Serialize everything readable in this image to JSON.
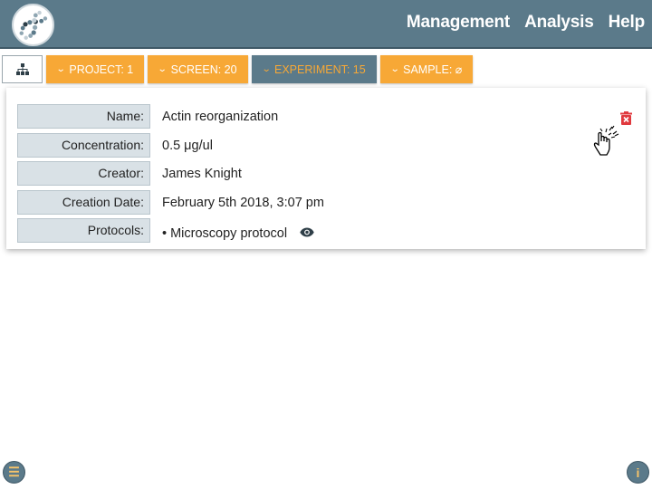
{
  "nav": {
    "items": [
      "Management",
      "Analysis",
      "Help"
    ]
  },
  "breadcrumbs": [
    {
      "label": "PROJECT: 1",
      "active": false
    },
    {
      "label": "SCREEN: 20",
      "active": false
    },
    {
      "label": "EXPERIMENT: 15",
      "active": true
    },
    {
      "label": "SAMPLE: ⌀",
      "active": false
    }
  ],
  "details": {
    "name_label": "Name:",
    "name_value": "Actin reorganization",
    "concentration_label": "Concentration:",
    "concentration_value": "0.5 μg/ul",
    "creator_label": "Creator:",
    "creator_value": "James Knight",
    "date_label": "Creation Date:",
    "date_value": "February 5th 2018, 3:07 pm",
    "protocols_label": "Protocols:",
    "protocols_value": "• Microscopy protocol"
  },
  "icons": {
    "logo": "dna-logo",
    "tree": "hierarchy-icon",
    "delete": "trash-delete-icon",
    "view": "eye-icon",
    "menu": "menu-icon",
    "info": "info-icon"
  },
  "colors": {
    "header": "#5b7a8a",
    "accent": "#f7a836",
    "delete": "#e0393e"
  }
}
